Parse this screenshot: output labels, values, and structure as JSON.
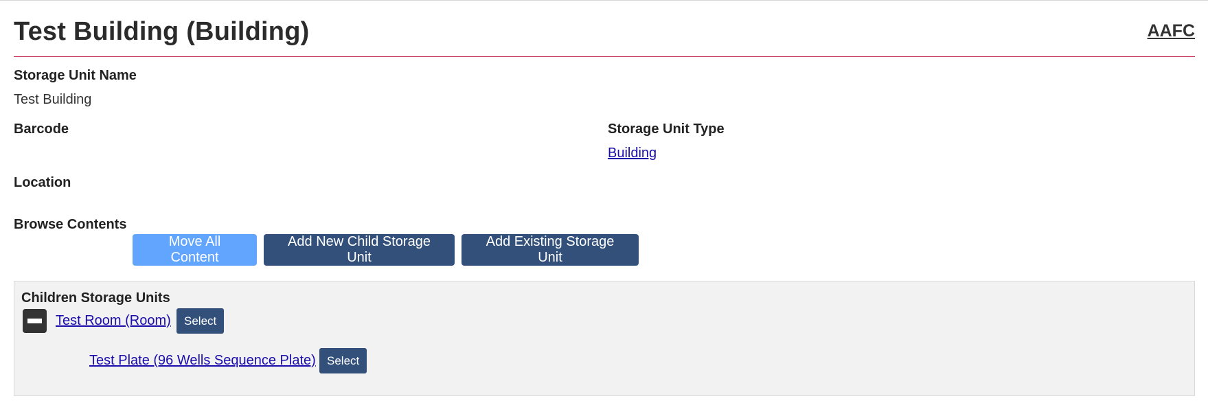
{
  "header": {
    "title": "Test Building (Building)",
    "brand": "AAFC"
  },
  "fields": {
    "storage_unit_name": {
      "label": "Storage Unit Name",
      "value": "Test Building"
    },
    "barcode": {
      "label": "Barcode",
      "value": ""
    },
    "storage_unit_type": {
      "label": "Storage Unit Type",
      "value": "Building"
    },
    "location": {
      "label": "Location",
      "value": ""
    }
  },
  "browse": {
    "label": "Browse Contents",
    "move_all": "Move All Content",
    "add_new_child": "Add New Child Storage Unit",
    "add_existing": "Add Existing Storage Unit"
  },
  "children": {
    "title": "Children Storage Units",
    "items": [
      {
        "label": "Test Room (Room)",
        "select": "Select"
      },
      {
        "label": "Test Plate (96 Wells Sequence Plate)",
        "select": "Select"
      }
    ]
  },
  "colors": {
    "accent_rule": "#c4364f",
    "primary_button": "#33507a",
    "light_button": "#62a5ff",
    "link": "#1a0dab"
  }
}
